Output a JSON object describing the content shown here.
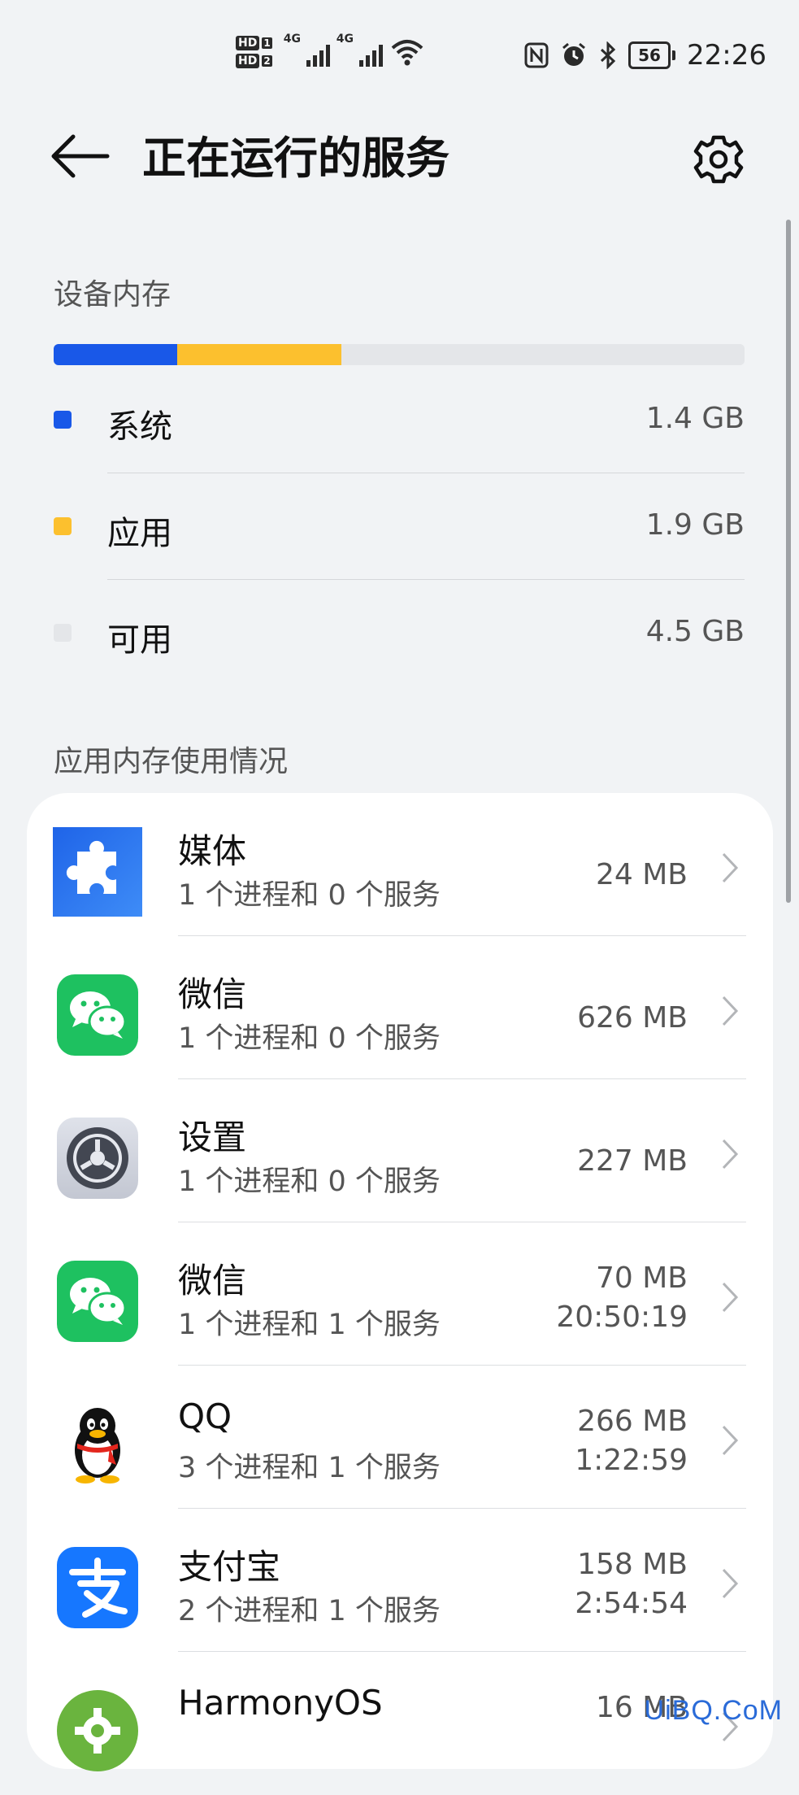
{
  "status_bar": {
    "hd1": "HD",
    "hd1_num": "1",
    "hd2": "HD",
    "hd2_num": "2",
    "sig1_label": "4G",
    "sig2_label": "4G",
    "battery": "56",
    "time": "22:26"
  },
  "header": {
    "title": "正在运行的服务"
  },
  "memory": {
    "section_label": "设备内存",
    "bar": [
      {
        "name": "系统",
        "fraction": 0.179,
        "color": "#1958e8"
      },
      {
        "name": "应用",
        "fraction": 0.237,
        "color": "#fcc02e"
      },
      {
        "name": "可用",
        "fraction": 0.584,
        "color": "#e4e6e9"
      }
    ],
    "legend": [
      {
        "label": "系统",
        "value": "1.4 GB",
        "color": "#1958e8"
      },
      {
        "label": "应用",
        "value": "1.9 GB",
        "color": "#fcc02e"
      },
      {
        "label": "可用",
        "value": "4.5 GB",
        "color": "#e4e6e9"
      }
    ]
  },
  "apps_section": {
    "label": "应用内存使用情况",
    "items": [
      {
        "name": "媒体",
        "sub": "1 个进程和 0 个服务",
        "size": "24 MB",
        "time": "",
        "icon": "puzzle-icon"
      },
      {
        "name": "微信",
        "sub": "1 个进程和 0 个服务",
        "size": "626 MB",
        "time": "",
        "icon": "wechat-icon"
      },
      {
        "name": "设置",
        "sub": "1 个进程和 0 个服务",
        "size": "227 MB",
        "time": "",
        "icon": "settings-app-icon"
      },
      {
        "name": "微信",
        "sub": "1 个进程和 1 个服务",
        "size": "70 MB",
        "time": "20:50:19",
        "icon": "wechat-icon"
      },
      {
        "name": "QQ",
        "sub": "3 个进程和 1 个服务",
        "size": "266 MB",
        "time": "1:22:59",
        "icon": "qq-penguin-icon"
      },
      {
        "name": "支付宝",
        "sub": "2 个进程和 1 个服务",
        "size": "158 MB",
        "time": "2:54:54",
        "icon": "alipay-icon"
      },
      {
        "name": "HarmonyOS",
        "sub": "",
        "size": "16 MB",
        "time": "",
        "icon": "harmonyos-gear-icon"
      }
    ]
  },
  "watermark": "UiBQ.CoM"
}
